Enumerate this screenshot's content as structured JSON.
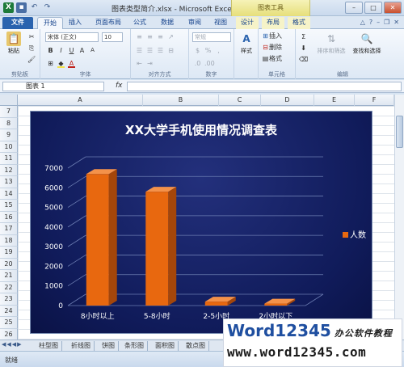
{
  "window": {
    "title": "图表类型简介.xlsx - Microsoft Excel",
    "context_tab_group": "图表工具"
  },
  "tabs": [
    "文件",
    "开始",
    "插入",
    "页面布局",
    "公式",
    "数据",
    "审阅",
    "视图",
    "设计",
    "布局",
    "格式"
  ],
  "ribbon": {
    "clipboard": {
      "paste": "粘贴",
      "label": "剪贴板"
    },
    "font": {
      "name": "宋体 (正文)",
      "size": "10",
      "label": "字体",
      "bold": "B",
      "italic": "I",
      "underline": "U"
    },
    "alignment": {
      "label": "对齐方式"
    },
    "number": {
      "format": "常规",
      "label": "数字",
      "percent": "%",
      "comma": ","
    },
    "styles": {
      "style_button": "样式"
    },
    "cells": {
      "insert": "插入",
      "delete": "删除",
      "format": "格式",
      "label": "单元格"
    },
    "editing": {
      "sort": "排序和筛选",
      "find": "查找和选择",
      "label": "编辑",
      "sum": "Σ"
    }
  },
  "formula_bar": {
    "name_box": "图表 1",
    "fx": "fx",
    "formula": ""
  },
  "columns": [
    "A",
    "B",
    "C",
    "D",
    "E",
    "F"
  ],
  "rows": [
    "7",
    "8",
    "9",
    "10",
    "11",
    "12",
    "13",
    "14",
    "15",
    "16",
    "17",
    "18",
    "19",
    "20",
    "21",
    "22",
    "23",
    "24",
    "25",
    "26"
  ],
  "chart_data": {
    "type": "bar",
    "title": "XX大学手机使用情况调查表",
    "categories": [
      "8小时以上",
      "5-8小时",
      "2-5小时",
      "2小时以下"
    ],
    "series": [
      {
        "name": "人数",
        "values": [
          6700,
          5800,
          200,
          100
        ]
      }
    ],
    "ylim": [
      0,
      7000
    ],
    "yticks": [
      0,
      1000,
      2000,
      3000,
      4000,
      5000,
      6000,
      7000
    ],
    "legend_position": "right",
    "grid": true,
    "style": "3d-column",
    "colors": {
      "bar": "#e8680f",
      "bar_side": "#a4460a",
      "bar_top": "#f4924a",
      "background": "#141f64",
      "text": "#ffffff",
      "grid": "#6a7bb0"
    }
  },
  "sheet_tabs": [
    "柱型图",
    "折线图",
    "饼图",
    "条形图",
    "面积图",
    "散点图"
  ],
  "status": {
    "ready": "就绪"
  },
  "watermark": {
    "line1": "Word12345",
    "line1_cn": "办公软件教程",
    "line2": "www.word12345.com"
  }
}
